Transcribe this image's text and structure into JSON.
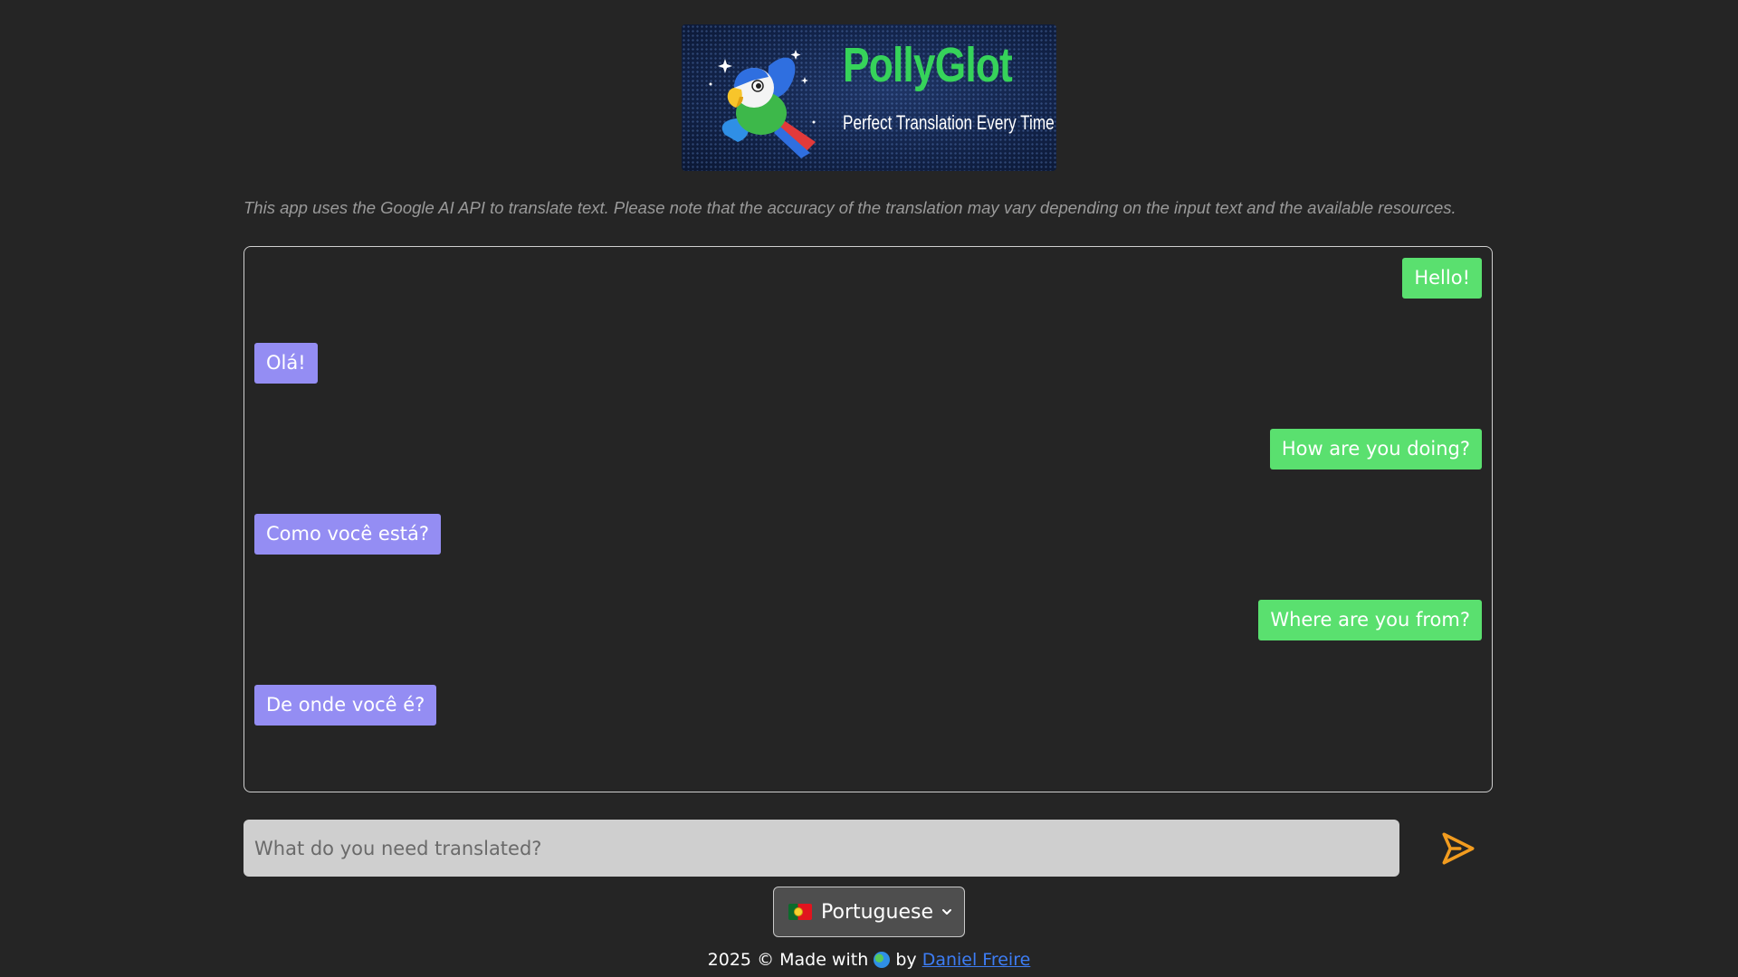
{
  "header": {
    "logo_title": "PollyGlot",
    "logo_tagline": "Perfect Translation Every Time",
    "disclaimer": "This app uses the Google AI API to translate text. Please note that the accuracy of the translation may vary depending on the input text and the available resources."
  },
  "chat": {
    "messages": [
      {
        "role": "user",
        "text": "Hello!"
      },
      {
        "role": "bot",
        "text": "Olá!"
      },
      {
        "role": "user",
        "text": "How are you doing?"
      },
      {
        "role": "bot",
        "text": "Como você está?"
      },
      {
        "role": "user",
        "text": "Where are you from?"
      },
      {
        "role": "bot",
        "text": "De onde você é?"
      }
    ]
  },
  "input": {
    "placeholder": "What do you need translated?",
    "value": ""
  },
  "language": {
    "selected": "Portuguese",
    "flag_icon": "portugal-flag-icon"
  },
  "footer": {
    "prefix": "2025 © Made with",
    "by": "by",
    "author": "Daniel Freire"
  },
  "colors": {
    "background": "#252525",
    "user_bubble": "#5ae06f",
    "bot_bubble": "#948df3",
    "send_icon": "#f29c1f",
    "link": "#3d7df5"
  }
}
